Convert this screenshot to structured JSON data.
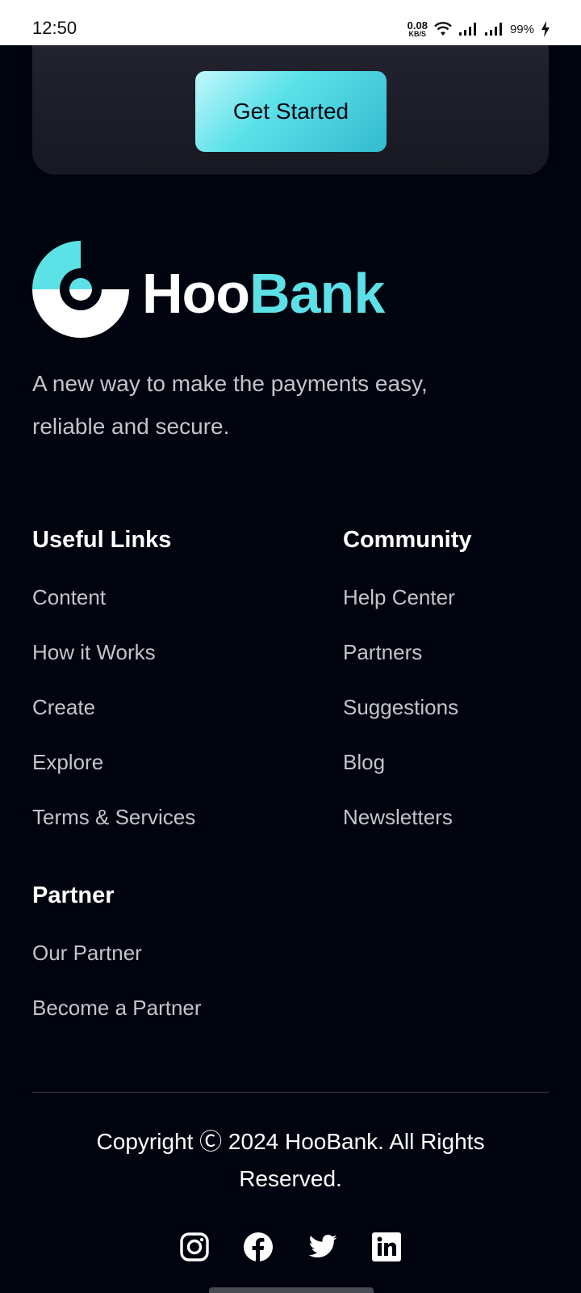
{
  "status_bar": {
    "time": "12:50",
    "net_speed_value": "0.08",
    "net_speed_unit": "KB/S",
    "battery": "99%",
    "icons": [
      "wifi-icon",
      "signal-icon",
      "signal-icon",
      "charging-icon"
    ]
  },
  "cta": {
    "button_label": "Get Started"
  },
  "brand": {
    "name_part1": "Hoo",
    "name_part2": "Bank",
    "accent_color": "#5ce1e6",
    "tagline": "A new way to make the payments easy, reliable and secure."
  },
  "footer": {
    "useful_links": {
      "title": "Useful Links",
      "items": [
        "Content",
        "How it Works",
        "Create",
        "Explore",
        "Terms & Services"
      ]
    },
    "community": {
      "title": "Community",
      "items": [
        "Help Center",
        "Partners",
        "Suggestions",
        "Blog",
        "Newsletters"
      ]
    },
    "partner": {
      "title": "Partner",
      "items": [
        "Our Partner",
        "Become a Partner"
      ]
    },
    "copyright": "Copyright Ⓒ 2024 HooBank. All Rights Reserved.",
    "social_icons": [
      "instagram-icon",
      "facebook-icon",
      "twitter-icon",
      "linkedin-icon"
    ]
  },
  "colors": {
    "background": "#00040f",
    "card": "#1c1c26",
    "button_gradient_start": "#c2f8fb",
    "button_gradient_end": "#33bbcf",
    "link_text": "#c4c4c9"
  }
}
